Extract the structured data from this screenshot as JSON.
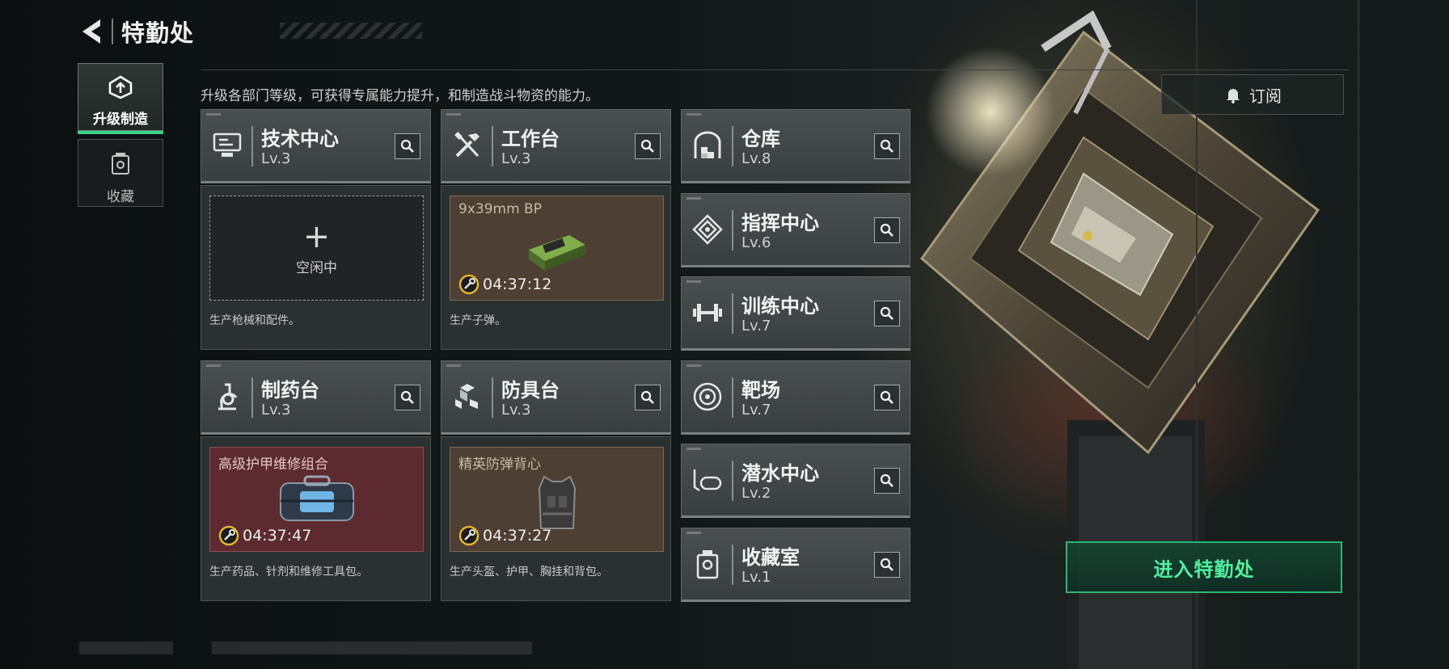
{
  "header": {
    "title": "特勤处"
  },
  "nav": [
    {
      "id": "upgrade",
      "label": "升级制造",
      "active": true,
      "icon": "upgrade-icon"
    },
    {
      "id": "collect",
      "label": "收藏",
      "active": false,
      "icon": "collection-icon"
    }
  ],
  "description": "升级各部门等级，可获得专属能力提升，和制造战斗物资的能力。",
  "subscribe": {
    "label": "订阅",
    "icon": "bell-icon"
  },
  "departments": {
    "tech": {
      "name": "技术中心",
      "level": "Lv.3",
      "icon": "tech-center-icon",
      "slot": {
        "state": "idle",
        "plus": "+",
        "idle_label": "空闲中"
      },
      "desc": "生产枪械和配件。"
    },
    "workbench": {
      "name": "工作台",
      "level": "Lv.3",
      "icon": "workbench-icon",
      "slot": {
        "item": "9x39mm BP",
        "timer": "04:37:12"
      },
      "desc": "生产子弹。"
    },
    "pharmacy": {
      "name": "制药台",
      "level": "Lv.3",
      "icon": "pharmacy-icon",
      "slot": {
        "item": "高级护甲维修组合",
        "timer": "04:37:47"
      },
      "desc": "生产药品、针剂和维修工具包。"
    },
    "armor": {
      "name": "防具台",
      "level": "Lv.3",
      "icon": "armor-bench-icon",
      "slot": {
        "item": "精英防弹背心",
        "timer": "04:37:27"
      },
      "desc": "生产头盔、护甲、胸挂和背包。"
    },
    "warehouse": {
      "name": "仓库",
      "level": "Lv.8",
      "icon": "warehouse-icon"
    },
    "command": {
      "name": "指挥中心",
      "level": "Lv.6",
      "icon": "command-center-icon"
    },
    "training": {
      "name": "训练中心",
      "level": "Lv.7",
      "icon": "dumbbell-icon"
    },
    "range": {
      "name": "靶场",
      "level": "Lv.7",
      "icon": "target-icon"
    },
    "diving": {
      "name": "潜水中心",
      "level": "Lv.2",
      "icon": "diving-mask-icon"
    },
    "vault": {
      "name": "收藏室",
      "level": "Lv.1",
      "icon": "vault-icon"
    }
  },
  "enter_button": {
    "label": "进入特勤处"
  },
  "colors": {
    "accent": "#35d68a",
    "enter_text": "#4ff0a0",
    "brown_slot": "#4d3f33",
    "red_slot": "#5c2b30"
  }
}
